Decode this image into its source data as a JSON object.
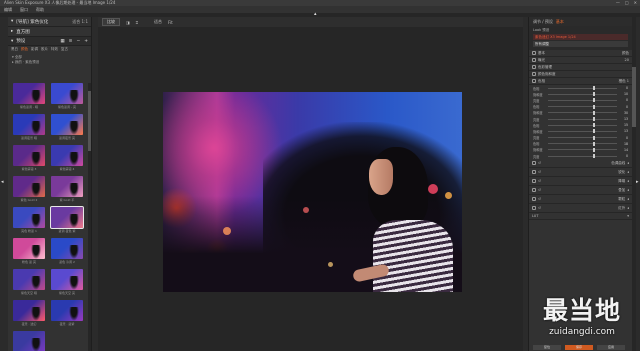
{
  "window": {
    "title": "Alien Skin Exposure X3 人像后期处理 - 最当地 Image 1/24",
    "controls": [
      "—",
      "□",
      "✕"
    ]
  },
  "menu": {
    "items": [
      "编辑",
      "窗口",
      "帮助"
    ]
  },
  "left_panel": {
    "section1_title": "[导航] 紫色仪化",
    "section1_right": "适合  1:1",
    "section2_title": "直方图",
    "preset_title": "预设",
    "tabs": [
      "黑白",
      "颜色",
      "影调",
      "胶片",
      "特效",
      "复古"
    ],
    "active_tab": 1,
    "tree": [
      "▾ 全部",
      "  ▸ 我的 · 紫色预设"
    ],
    "thumbnails": [
      {
        "caption": "紫色蓝调 - 暗",
        "colors": [
          "#4a2a9a",
          "#e2467a"
        ]
      },
      {
        "caption": "紫色蓝调 - 亮",
        "colors": [
          "#3a4ad0",
          "#c05a9a"
        ]
      },
      {
        "caption": "蓝调夜景 暗",
        "colors": [
          "#2a3ab8",
          "#b03a8a"
        ]
      },
      {
        "caption": "蓝调夜景 亮",
        "colors": [
          "#3050d0",
          "#ff7a4a"
        ]
      },
      {
        "caption": "紫色雾霾 3",
        "colors": [
          "#5a2a8a",
          "#e04a6a"
        ]
      },
      {
        "caption": "紫色雾霾 4",
        "colors": [
          "#3a3ab0",
          "#d04aa0"
        ]
      },
      {
        "caption": "紫色 Gold 2",
        "colors": [
          "#602a8a",
          "#e06a4a"
        ]
      },
      {
        "caption": "紫 Gold 平",
        "colors": [
          "#7a3a9a",
          "#f0a0c0"
        ]
      },
      {
        "caption": "亮色 粉蓝 1",
        "colors": [
          "#3a4ac0",
          "#b04aa0"
        ]
      },
      {
        "caption": "蓝调 夜色 紫",
        "colors": [
          "#6a3aa0",
          "#f07a8a"
        ]
      },
      {
        "caption": "粉色 蓝 亮",
        "colors": [
          "#d04a9a",
          "#ffc0d0"
        ]
      },
      {
        "caption": "蓝色 冷调 2",
        "colors": [
          "#2a4ac8",
          "#8a4ab0"
        ]
      },
      {
        "caption": "紫色天空 暗",
        "colors": [
          "#4a3ab0",
          "#c04a8a"
        ]
      },
      {
        "caption": "紫色天空 亮",
        "colors": [
          "#5a4ad0",
          "#e05aa0"
        ]
      },
      {
        "caption": "夜景 · 迷幻",
        "colors": [
          "#3a2a9a",
          "#ff5a6a"
        ]
      },
      {
        "caption": "夜景 · 蓝紫",
        "colors": [
          "#2a3ab0",
          "#9a3ac0"
        ]
      },
      {
        "caption": "紫 · 冷",
        "colors": [
          "#3a3aa0",
          "#7a3ac0"
        ]
      }
    ],
    "selected_index": 9
  },
  "center": {
    "toolbar": {
      "compare_label": "比较",
      "zoom_label": "适合",
      "view_label": "Fit"
    }
  },
  "right_panel": {
    "header_label": "调节 / 预设",
    "header_accent": "基本",
    "meta_label": "Look 预设",
    "meta_field": "",
    "meta_field_red": "紫色迷幻 X3 Image 1/24",
    "meta_label2": "所有调整",
    "section_rows": [
      {
        "label": "基本",
        "right": "颜色"
      },
      {
        "label": "曝光",
        "right": "20"
      },
      {
        "label": "色彩管理",
        "right": ""
      },
      {
        "label": "颜色饱和度",
        "right": ""
      },
      {
        "label": "色相",
        "right": "橙色 1"
      }
    ],
    "sliders": [
      {
        "label": "色相",
        "value": "0",
        "pos": 0.65
      },
      {
        "label": "饱和度",
        "value": "10",
        "pos": 0.65
      },
      {
        "label": "亮度",
        "value": "0",
        "pos": 0.65
      },
      {
        "label": "色相",
        "value": "0",
        "pos": 0.65
      },
      {
        "label": "饱和度",
        "value": "30",
        "pos": 0.65
      },
      {
        "label": "亮度",
        "value": "13",
        "pos": 0.65
      },
      {
        "label": "色相",
        "value": "15",
        "pos": 0.65
      },
      {
        "label": "饱和度",
        "value": "13",
        "pos": 0.65
      },
      {
        "label": "亮度",
        "value": "0",
        "pos": 0.65
      },
      {
        "label": "色相",
        "value": "18",
        "pos": 0.65
      },
      {
        "label": "饱和度",
        "value": "14",
        "pos": 0.65
      },
      {
        "label": "亮度",
        "value": "0",
        "pos": 0.65
      }
    ],
    "panels": [
      {
        "label": "色调曲线"
      },
      {
        "label": "锐化"
      },
      {
        "label": "降噪"
      },
      {
        "label": "叠加"
      },
      {
        "label": "颗粒"
      },
      {
        "label": "红外"
      }
    ],
    "bottom_section": "LUT",
    "bottom_buttons": [
      "复位",
      "保存",
      "应用"
    ]
  },
  "watermark": {
    "big": "最当地",
    "small": "zuidangdi.com"
  }
}
